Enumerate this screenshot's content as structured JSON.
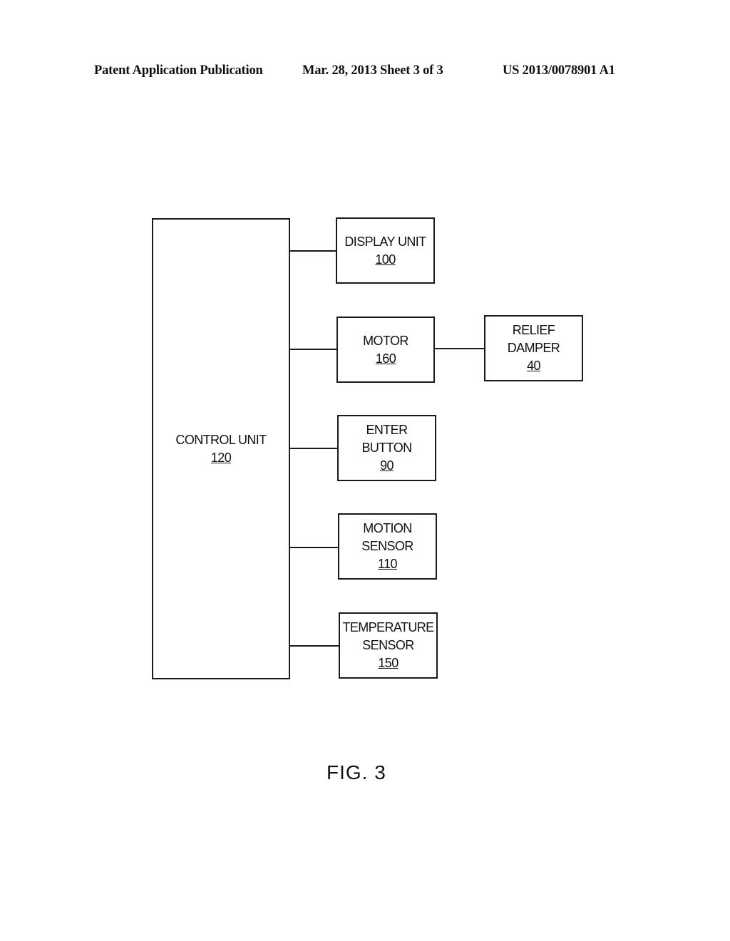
{
  "header": {
    "left": "Patent Application Publication",
    "middle": "Mar. 28, 2013  Sheet 3 of 3",
    "right": "US 2013/0078901 A1"
  },
  "diagram": {
    "control_unit": {
      "label": "CONTROL UNIT",
      "ref": "120"
    },
    "blocks": [
      {
        "lines": [
          "DISPLAY UNIT"
        ],
        "ref": "100"
      },
      {
        "lines": [
          "MOTOR"
        ],
        "ref": "160"
      },
      {
        "lines": [
          "ENTER",
          "BUTTON"
        ],
        "ref": "90"
      },
      {
        "lines": [
          "MOTION",
          "SENSOR"
        ],
        "ref": "110"
      },
      {
        "lines": [
          "TEMPERATURE",
          "SENSOR"
        ],
        "ref": "150"
      }
    ],
    "relief_damper": {
      "lines": [
        "RELIEF",
        "DAMPER"
      ],
      "ref": "40"
    }
  },
  "figure_label": "FIG. 3"
}
